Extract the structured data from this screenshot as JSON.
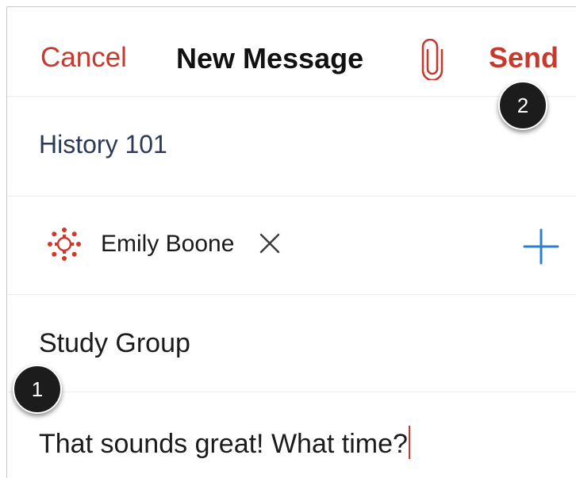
{
  "header": {
    "cancel_label": "Cancel",
    "title": "New Message",
    "attach_icon": "paperclip-icon",
    "send_label": "Send"
  },
  "course": {
    "name": "History 101"
  },
  "recipients": [
    {
      "name": "Emily Boone",
      "avatar_icon": "canvas-logo-icon",
      "remove_icon": "close-icon"
    }
  ],
  "add_recipient_icon": "plus-icon",
  "subject": {
    "value": "Study Group"
  },
  "message": {
    "value": "That sounds great! What time?"
  },
  "markers": [
    "1",
    "2"
  ],
  "colors": {
    "accent": "#c8392d",
    "link_blue": "#2d7fd1",
    "course_text": "#2c3a57"
  }
}
